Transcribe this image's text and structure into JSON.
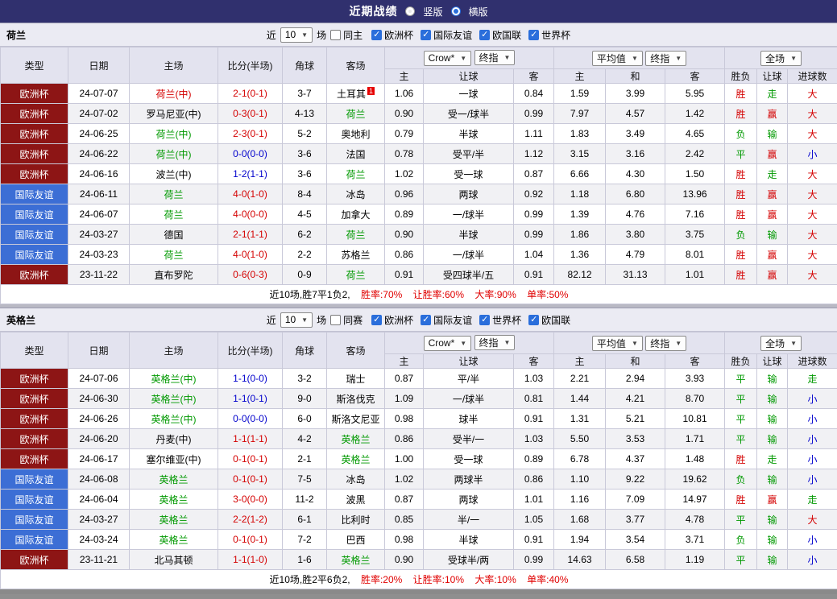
{
  "titlebar": {
    "title": "近期战绩",
    "options": [
      {
        "label": "竖版",
        "selected": false
      },
      {
        "label": "横版",
        "selected": true
      }
    ]
  },
  "colors": {
    "topbar_bg": "#30306e",
    "cup_bg": "#8d1515",
    "friendly_bg": "#3c6ed5",
    "win_red": "#d40000",
    "draw_green": "#009900",
    "loss_blue": "#0000cc"
  },
  "table_headers": {
    "cols": [
      "类型",
      "日期",
      "主场",
      "比分(半场)",
      "角球",
      "客场"
    ],
    "odds_sub": [
      "主",
      "让球",
      "客",
      "主",
      "和",
      "客"
    ],
    "result_sub": [
      "胜负",
      "让球",
      "进球数"
    ]
  },
  "dropdowns": {
    "book": "Crow*",
    "book_time": "终指",
    "avg": "平均值",
    "avg_time": "终指",
    "scope": "全场"
  },
  "sections": [
    {
      "team": "荷兰",
      "filter": {
        "near": "近",
        "count": "10",
        "unit": "场",
        "same": {
          "label": "同主",
          "checked": false
        },
        "leagues": [
          {
            "label": "欧洲杯",
            "checked": true
          },
          {
            "label": "国际友谊",
            "checked": true
          },
          {
            "label": "欧国联",
            "checked": true
          },
          {
            "label": "世界杯",
            "checked": true
          }
        ]
      },
      "rows": [
        {
          "type": "欧洲杯",
          "tcls": "cup",
          "date": "24-07-07",
          "home": "荷兰(中)",
          "hcls": "red",
          "score": "2-1(0-1)",
          "scls": "red",
          "corner": "3-7",
          "away": "土耳其",
          "acls": "black",
          "badge": "1",
          "odds": [
            "1.06",
            "一球",
            "0.84",
            "1.59",
            "3.99",
            "5.95"
          ],
          "res": [
            [
              "胜",
              "red"
            ],
            [
              "走",
              "green"
            ],
            [
              "大",
              "red"
            ]
          ]
        },
        {
          "type": "欧洲杯",
          "tcls": "cup",
          "date": "24-07-02",
          "home": "罗马尼亚(中)",
          "hcls": "black",
          "score": "0-3(0-1)",
          "scls": "red",
          "corner": "4-13",
          "away": "荷兰",
          "acls": "green",
          "odds": [
            "0.90",
            "受一/球半",
            "0.99",
            "7.97",
            "4.57",
            "1.42"
          ],
          "res": [
            [
              "胜",
              "red"
            ],
            [
              "赢",
              "red"
            ],
            [
              "大",
              "red"
            ]
          ]
        },
        {
          "type": "欧洲杯",
          "tcls": "cup",
          "date": "24-06-25",
          "home": "荷兰(中)",
          "hcls": "green",
          "score": "2-3(0-1)",
          "scls": "red",
          "corner": "5-2",
          "away": "奥地利",
          "acls": "black",
          "odds": [
            "0.79",
            "半球",
            "1.11",
            "1.83",
            "3.49",
            "4.65"
          ],
          "res": [
            [
              "负",
              "green"
            ],
            [
              "输",
              "green"
            ],
            [
              "大",
              "red"
            ]
          ]
        },
        {
          "type": "欧洲杯",
          "tcls": "cup",
          "date": "24-06-22",
          "home": "荷兰(中)",
          "hcls": "green",
          "score": "0-0(0-0)",
          "scls": "blue",
          "corner": "3-6",
          "away": "法国",
          "acls": "black",
          "odds": [
            "0.78",
            "受平/半",
            "1.12",
            "3.15",
            "3.16",
            "2.42"
          ],
          "res": [
            [
              "平",
              "green"
            ],
            [
              "赢",
              "red"
            ],
            [
              "小",
              "blue"
            ]
          ]
        },
        {
          "type": "欧洲杯",
          "tcls": "cup",
          "date": "24-06-16",
          "home": "波兰(中)",
          "hcls": "black",
          "score": "1-2(1-1)",
          "scls": "blue",
          "corner": "3-6",
          "away": "荷兰",
          "acls": "green",
          "odds": [
            "1.02",
            "受一球",
            "0.87",
            "6.66",
            "4.30",
            "1.50"
          ],
          "res": [
            [
              "胜",
              "red"
            ],
            [
              "走",
              "green"
            ],
            [
              "大",
              "red"
            ]
          ]
        },
        {
          "type": "国际友谊",
          "tcls": "fri",
          "date": "24-06-11",
          "home": "荷兰",
          "hcls": "green",
          "score": "4-0(1-0)",
          "scls": "red",
          "corner": "8-4",
          "away": "冰岛",
          "acls": "black",
          "odds": [
            "0.96",
            "两球",
            "0.92",
            "1.18",
            "6.80",
            "13.96"
          ],
          "res": [
            [
              "胜",
              "red"
            ],
            [
              "赢",
              "red"
            ],
            [
              "大",
              "red"
            ]
          ]
        },
        {
          "type": "国际友谊",
          "tcls": "fri",
          "date": "24-06-07",
          "home": "荷兰",
          "hcls": "green",
          "score": "4-0(0-0)",
          "scls": "red",
          "corner": "4-5",
          "away": "加拿大",
          "acls": "black",
          "odds": [
            "0.89",
            "一/球半",
            "0.99",
            "1.39",
            "4.76",
            "7.16"
          ],
          "res": [
            [
              "胜",
              "red"
            ],
            [
              "赢",
              "red"
            ],
            [
              "大",
              "red"
            ]
          ]
        },
        {
          "type": "国际友谊",
          "tcls": "fri",
          "date": "24-03-27",
          "home": "德国",
          "hcls": "black",
          "score": "2-1(1-1)",
          "scls": "red",
          "corner": "6-2",
          "away": "荷兰",
          "acls": "green",
          "odds": [
            "0.90",
            "半球",
            "0.99",
            "1.86",
            "3.80",
            "3.75"
          ],
          "res": [
            [
              "负",
              "green"
            ],
            [
              "输",
              "green"
            ],
            [
              "大",
              "red"
            ]
          ]
        },
        {
          "type": "国际友谊",
          "tcls": "fri",
          "date": "24-03-23",
          "home": "荷兰",
          "hcls": "green",
          "score": "4-0(1-0)",
          "scls": "red",
          "corner": "2-2",
          "away": "苏格兰",
          "acls": "black",
          "odds": [
            "0.86",
            "一/球半",
            "1.04",
            "1.36",
            "4.79",
            "8.01"
          ],
          "res": [
            [
              "胜",
              "red"
            ],
            [
              "赢",
              "red"
            ],
            [
              "大",
              "red"
            ]
          ]
        },
        {
          "type": "欧洲杯",
          "tcls": "cup",
          "date": "23-11-22",
          "home": "直布罗陀",
          "hcls": "black",
          "score": "0-6(0-3)",
          "scls": "red",
          "corner": "0-9",
          "away": "荷兰",
          "acls": "green",
          "odds": [
            "0.91",
            "受四球半/五",
            "0.91",
            "82.12",
            "31.13",
            "1.01"
          ],
          "res": [
            [
              "胜",
              "red"
            ],
            [
              "赢",
              "red"
            ],
            [
              "大",
              "red"
            ]
          ]
        }
      ],
      "summary": {
        "text": "近10场,胜7平1负2,",
        "stats": [
          {
            "label": "胜率:",
            "value": "70%"
          },
          {
            "label": "让胜率:",
            "value": "60%"
          },
          {
            "label": "大率:",
            "value": "90%"
          },
          {
            "label": "单率:",
            "value": "50%"
          }
        ]
      }
    },
    {
      "team": "英格兰",
      "filter": {
        "near": "近",
        "count": "10",
        "unit": "场",
        "same": {
          "label": "同赛",
          "checked": false
        },
        "leagues": [
          {
            "label": "欧洲杯",
            "checked": true
          },
          {
            "label": "国际友谊",
            "checked": true
          },
          {
            "label": "世界杯",
            "checked": true
          },
          {
            "label": "欧国联",
            "checked": true
          }
        ]
      },
      "rows": [
        {
          "type": "欧洲杯",
          "tcls": "cup",
          "date": "24-07-06",
          "home": "英格兰(中)",
          "hcls": "green",
          "score": "1-1(0-0)",
          "scls": "blue",
          "corner": "3-2",
          "away": "瑞士",
          "acls": "black",
          "odds": [
            "0.87",
            "平/半",
            "1.03",
            "2.21",
            "2.94",
            "3.93"
          ],
          "res": [
            [
              "平",
              "green"
            ],
            [
              "输",
              "green"
            ],
            [
              "走",
              "green"
            ]
          ]
        },
        {
          "type": "欧洲杯",
          "tcls": "cup",
          "date": "24-06-30",
          "home": "英格兰(中)",
          "hcls": "green",
          "score": "1-1(0-1)",
          "scls": "blue",
          "corner": "9-0",
          "away": "斯洛伐克",
          "acls": "black",
          "odds": [
            "1.09",
            "一/球半",
            "0.81",
            "1.44",
            "4.21",
            "8.70"
          ],
          "res": [
            [
              "平",
              "green"
            ],
            [
              "输",
              "green"
            ],
            [
              "小",
              "blue"
            ]
          ]
        },
        {
          "type": "欧洲杯",
          "tcls": "cup",
          "date": "24-06-26",
          "home": "英格兰(中)",
          "hcls": "green",
          "score": "0-0(0-0)",
          "scls": "blue",
          "corner": "6-0",
          "away": "斯洛文尼亚",
          "acls": "black",
          "odds": [
            "0.98",
            "球半",
            "0.91",
            "1.31",
            "5.21",
            "10.81"
          ],
          "res": [
            [
              "平",
              "green"
            ],
            [
              "输",
              "green"
            ],
            [
              "小",
              "blue"
            ]
          ]
        },
        {
          "type": "欧洲杯",
          "tcls": "cup",
          "date": "24-06-20",
          "home": "丹麦(中)",
          "hcls": "black",
          "score": "1-1(1-1)",
          "scls": "red",
          "corner": "4-2",
          "away": "英格兰",
          "acls": "green",
          "odds": [
            "0.86",
            "受半/一",
            "1.03",
            "5.50",
            "3.53",
            "1.71"
          ],
          "res": [
            [
              "平",
              "green"
            ],
            [
              "输",
              "green"
            ],
            [
              "小",
              "blue"
            ]
          ]
        },
        {
          "type": "欧洲杯",
          "tcls": "cup",
          "date": "24-06-17",
          "home": "塞尔维亚(中)",
          "hcls": "black",
          "score": "0-1(0-1)",
          "scls": "red",
          "corner": "2-1",
          "away": "英格兰",
          "acls": "green",
          "odds": [
            "1.00",
            "受一球",
            "0.89",
            "6.78",
            "4.37",
            "1.48"
          ],
          "res": [
            [
              "胜",
              "red"
            ],
            [
              "走",
              "green"
            ],
            [
              "小",
              "blue"
            ]
          ]
        },
        {
          "type": "国际友谊",
          "tcls": "fri",
          "date": "24-06-08",
          "home": "英格兰",
          "hcls": "green",
          "score": "0-1(0-1)",
          "scls": "red",
          "corner": "7-5",
          "away": "冰岛",
          "acls": "black",
          "odds": [
            "1.02",
            "两球半",
            "0.86",
            "1.10",
            "9.22",
            "19.62"
          ],
          "res": [
            [
              "负",
              "green"
            ],
            [
              "输",
              "green"
            ],
            [
              "小",
              "blue"
            ]
          ]
        },
        {
          "type": "国际友谊",
          "tcls": "fri",
          "date": "24-06-04",
          "home": "英格兰",
          "hcls": "green",
          "score": "3-0(0-0)",
          "scls": "red",
          "corner": "11-2",
          "away": "波黑",
          "acls": "black",
          "odds": [
            "0.87",
            "两球",
            "1.01",
            "1.16",
            "7.09",
            "14.97"
          ],
          "res": [
            [
              "胜",
              "red"
            ],
            [
              "赢",
              "red"
            ],
            [
              "走",
              "green"
            ]
          ]
        },
        {
          "type": "国际友谊",
          "tcls": "fri",
          "date": "24-03-27",
          "home": "英格兰",
          "hcls": "green",
          "score": "2-2(1-2)",
          "scls": "red",
          "corner": "6-1",
          "away": "比利时",
          "acls": "black",
          "odds": [
            "0.85",
            "半/一",
            "1.05",
            "1.68",
            "3.77",
            "4.78"
          ],
          "res": [
            [
              "平",
              "green"
            ],
            [
              "输",
              "green"
            ],
            [
              "大",
              "red"
            ]
          ]
        },
        {
          "type": "国际友谊",
          "tcls": "fri",
          "date": "24-03-24",
          "home": "英格兰",
          "hcls": "green",
          "score": "0-1(0-1)",
          "scls": "red",
          "corner": "7-2",
          "away": "巴西",
          "acls": "black",
          "odds": [
            "0.98",
            "半球",
            "0.91",
            "1.94",
            "3.54",
            "3.71"
          ],
          "res": [
            [
              "负",
              "green"
            ],
            [
              "输",
              "green"
            ],
            [
              "小",
              "blue"
            ]
          ]
        },
        {
          "type": "欧洲杯",
          "tcls": "cup",
          "date": "23-11-21",
          "home": "北马其顿",
          "hcls": "black",
          "score": "1-1(1-0)",
          "scls": "red",
          "corner": "1-6",
          "away": "英格兰",
          "acls": "green",
          "odds": [
            "0.90",
            "受球半/两",
            "0.99",
            "14.63",
            "6.58",
            "1.19"
          ],
          "res": [
            [
              "平",
              "green"
            ],
            [
              "输",
              "green"
            ],
            [
              "小",
              "blue"
            ]
          ]
        }
      ],
      "summary": {
        "text": "近10场,胜2平6负2,",
        "stats": [
          {
            "label": "胜率:",
            "value": "20%"
          },
          {
            "label": "让胜率:",
            "value": "10%"
          },
          {
            "label": "大率:",
            "value": "10%"
          },
          {
            "label": "单率:",
            "value": "40%"
          }
        ]
      }
    }
  ]
}
